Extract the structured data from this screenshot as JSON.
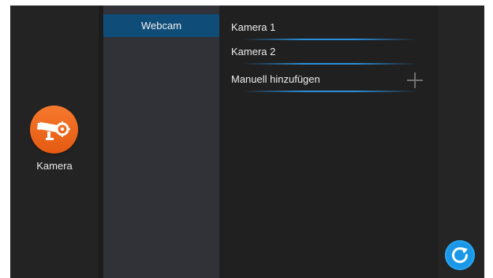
{
  "left": {
    "icon": "security-camera-icon",
    "label": "Kamera",
    "accent": "#f0701f"
  },
  "middle": {
    "items": [
      {
        "label": "Webcam",
        "active": true
      }
    ],
    "active_color": "#0f4d78"
  },
  "list": {
    "items": [
      {
        "label": "Kamera 1"
      },
      {
        "label": "Kamera 2"
      },
      {
        "label": "Manuell hinzufügen",
        "icon": "plus-icon"
      }
    ],
    "underline_color": "#2a8ed8"
  },
  "actions": {
    "refresh_icon": "refresh-icon",
    "refresh_color": "#1a97e6"
  }
}
